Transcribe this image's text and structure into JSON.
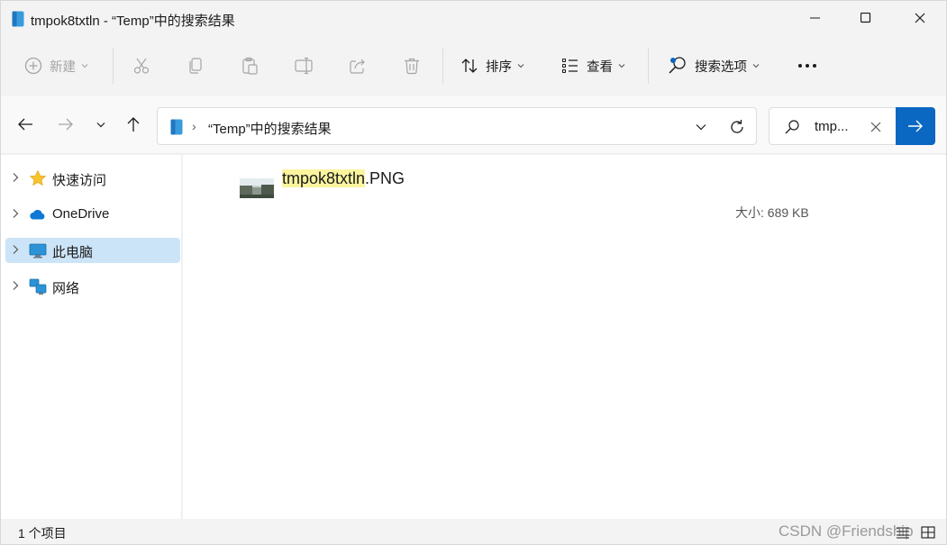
{
  "window": {
    "title": "tmpok8txtln - “Temp”中的搜索结果"
  },
  "toolbar": {
    "new_label": "新建",
    "sort_label": "排序",
    "view_label": "查看",
    "search_options_label": "搜索选项",
    "more_icon": "more-icon",
    "icons": [
      "plus-circle-icon",
      "cut-icon",
      "copy-icon",
      "paste-icon",
      "rename-icon",
      "share-icon",
      "delete-icon",
      "sort-icon",
      "view-list-icon",
      "search-options-icon"
    ]
  },
  "address": {
    "path": "“Temp”中的搜索结果"
  },
  "search": {
    "value": "tmp..."
  },
  "sidebar": {
    "items": [
      {
        "label": "快速访问",
        "icon": "star-icon"
      },
      {
        "label": "OneDrive",
        "icon": "cloud-icon"
      },
      {
        "label": "此电脑",
        "icon": "monitor-icon",
        "selected": true
      },
      {
        "label": "网络",
        "icon": "network-icon"
      }
    ]
  },
  "results": {
    "file": {
      "name_highlight": "tmpok8txtln",
      "name_rest": ".PNG",
      "size": "大小: 689 KB"
    }
  },
  "status": {
    "count": "1 个项目"
  },
  "watermark": "CSDN @Friendship",
  "colors": {
    "accent": "#0a67c2",
    "selected_bg": "#cce4f7",
    "highlight": "#fbf49f",
    "star": "#f7c32e"
  }
}
